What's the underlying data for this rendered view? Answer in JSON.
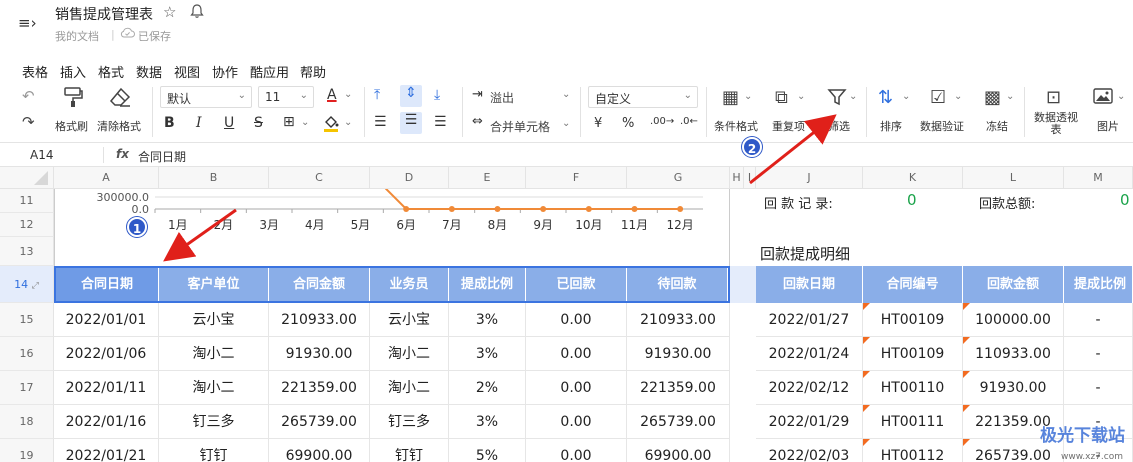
{
  "titlebar": {
    "menu_icon": "≡›",
    "doc_title": "销售提成管理表",
    "breadcrumb": "我的文档",
    "saved": "已保存"
  },
  "menubar": [
    "表格",
    "插入",
    "格式",
    "数据",
    "视图",
    "协作",
    "酷应用",
    "帮助"
  ],
  "toolbar": {
    "format_painter": "格式刷",
    "clear_format": "清除格式",
    "font": "默认",
    "font_size": "11",
    "overflow": "溢出",
    "merge_cells": "合并单元格",
    "number_format": "自定义",
    "currency": "¥",
    "percent": "%",
    "cond_format": "条件格式",
    "duplicates": "重复项",
    "filter": "筛选",
    "sort": "排序",
    "validation": "数据验证",
    "freeze": "冻结",
    "pivot": "数据透视表",
    "image": "图片"
  },
  "formula": {
    "cell_ref": "A14",
    "fx": "fx",
    "value": "合同日期"
  },
  "columns": [
    "A",
    "B",
    "C",
    "D",
    "E",
    "F",
    "G",
    "H",
    "I",
    "J",
    "K",
    "L",
    "M"
  ],
  "rows": [
    "11",
    "12",
    "13",
    "14",
    "15",
    "16",
    "17",
    "18",
    "19"
  ],
  "chart_data": {
    "type": "line",
    "categories": [
      "1月",
      "2月",
      "3月",
      "4月",
      "5月",
      "6月",
      "7月",
      "8月",
      "9月",
      "10月",
      "11月",
      "12月"
    ],
    "y_ticks": [
      "300000.0",
      "0.0"
    ],
    "series_color": "#f08a38"
  },
  "right_panel": {
    "record_label": "回 款 记 录:",
    "record_value": "0",
    "total_label": "回款总额:",
    "total_value": "0",
    "detail_title": "回款提成明细"
  },
  "left_table": {
    "headers": [
      "合同日期",
      "客户单位",
      "合同金额",
      "业务员",
      "提成比例",
      "已回款",
      "待回款"
    ],
    "rows": [
      [
        "2022/01/01",
        "云小宝",
        "210933.00",
        "云小宝",
        "3%",
        "0.00",
        "210933.00"
      ],
      [
        "2022/01/06",
        "淘小二",
        "91930.00",
        "淘小二",
        "3%",
        "0.00",
        "91930.00"
      ],
      [
        "2022/01/11",
        "淘小二",
        "221359.00",
        "淘小二",
        "2%",
        "0.00",
        "221359.00"
      ],
      [
        "2022/01/16",
        "钉三多",
        "265739.00",
        "钉三多",
        "3%",
        "0.00",
        "265739.00"
      ],
      [
        "2022/01/21",
        "钉钉",
        "69900.00",
        "钉钉",
        "5%",
        "0.00",
        "69900.00"
      ]
    ]
  },
  "right_table": {
    "headers": [
      "回款日期",
      "合同编号",
      "回款金额",
      "提成比例"
    ],
    "rows": [
      [
        "2022/01/27",
        "HT00109",
        "100000.00",
        "-"
      ],
      [
        "2022/01/24",
        "HT00109",
        "110933.00",
        "-"
      ],
      [
        "2022/02/12",
        "HT00110",
        "91930.00",
        "-"
      ],
      [
        "2022/01/29",
        "HT00111",
        "221359.00",
        "-"
      ],
      [
        "2022/02/03",
        "HT00112",
        "265739.00",
        "-"
      ]
    ]
  },
  "annotations": {
    "badge1": "1",
    "badge2": "2"
  },
  "watermark": {
    "text": "极光下载站",
    "url": "www.xz7.com"
  }
}
